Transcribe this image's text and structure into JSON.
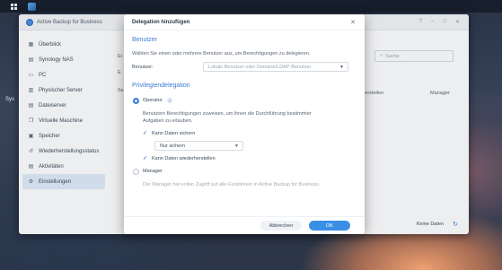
{
  "desktop": {
    "side_label": "Sys"
  },
  "window": {
    "title": "Active Backup for Business",
    "controls": [
      "?",
      "–",
      "□",
      "✕"
    ],
    "sidebar": [
      {
        "label": "Überblick",
        "icon": "overview-icon",
        "glyph": "▦"
      },
      {
        "label": "Synology NAS",
        "icon": "nas-icon",
        "glyph": "▤"
      },
      {
        "label": "PC",
        "icon": "pc-icon",
        "glyph": "▭"
      },
      {
        "label": "Physischer Server",
        "icon": "server-icon",
        "glyph": "▥"
      },
      {
        "label": "Dateiserver",
        "icon": "file-server-icon",
        "glyph": "▤"
      },
      {
        "label": "Virtuelle Maschine",
        "icon": "vm-icon",
        "glyph": "❒"
      },
      {
        "label": "Speicher",
        "icon": "storage-icon",
        "glyph": "▣"
      },
      {
        "label": "Wiederherstellungsstatus",
        "icon": "restore-status-icon",
        "glyph": "↺"
      },
      {
        "label": "Aktivitäten",
        "icon": "activity-icon",
        "glyph": "▤"
      },
      {
        "label": "Einstellungen",
        "icon": "settings-icon",
        "glyph": "⚙"
      }
    ],
    "active_index": 9,
    "bg_tab_1": "Ei",
    "bg_tab_2": "E",
    "bg_small": "Se",
    "search_placeholder": "Suche",
    "col_restore": "iederherstellen",
    "col_manager": "Manager",
    "footer": "Keine Daten"
  },
  "dialog": {
    "title": "Delegation hinzufügen",
    "users_section": "Benutzer",
    "users_desc": "Wählen Sie einen oder mehrere Benutzer aus, um Berechtigungen zu delegieren.",
    "user_label": "Benutzer:",
    "user_placeholder": "Lokale Benutzer oder Domäne/LDAP-Benutzer",
    "priv_section": "Privilegiendelegation",
    "operator_label": "Operator",
    "operator_desc_1": "Benutzern Berechtigungen zuweisen, um ihnen die Durchführung bestimmter",
    "operator_desc_2": "Aufgaben zu erlauben.",
    "backup_label": "Kann Daten sichern",
    "backup_select": "Nur sichern",
    "restore_label": "Kann Daten wiederherstellen",
    "manager_label": "Manager",
    "manager_desc": "Der Manager hat vollen Zugriff auf alle Funktionen in Active Backup for Business.",
    "cancel": "Abbrechen",
    "ok": "OK"
  },
  "colors": {
    "accent": "#3a7bd5",
    "ok_button": "#3a8ee6"
  }
}
